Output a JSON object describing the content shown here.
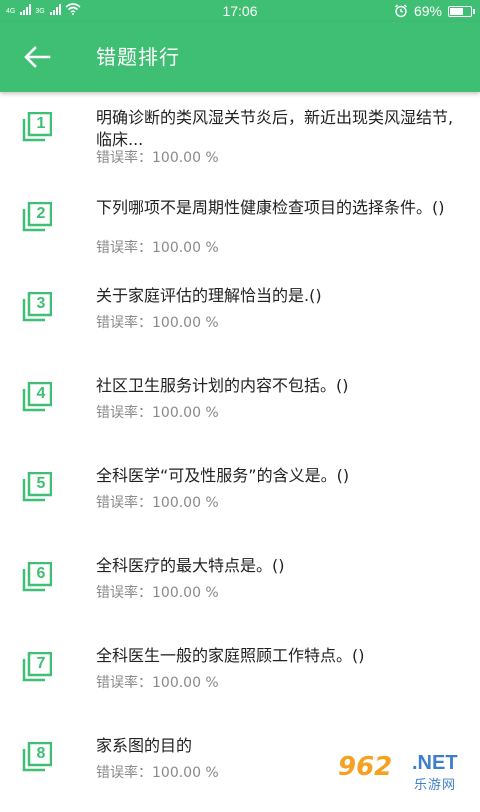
{
  "status_bar": {
    "network_1": "4G",
    "network_2": "3G",
    "time": "17:06",
    "alarm_icon": "alarm-clock-icon",
    "battery_percent_text": "69%",
    "battery_level": 0.69
  },
  "app_bar": {
    "back_icon": "arrow-back-icon",
    "title": "错题排行"
  },
  "theme": {
    "primary": "#3fbf74",
    "text_primary": "#222222",
    "text_secondary": "#8a8a8a"
  },
  "items": [
    {
      "rank": "1",
      "question": "明确诊断的类风湿关节炎后，新近出现类风湿结节,临床...",
      "rate_label": "错误率：",
      "rate": "100.00 %"
    },
    {
      "rank": "2",
      "question": "下列哪项不是周期性健康检查项目的选择条件。()",
      "rate_label": "错误率：",
      "rate": "100.00 %"
    },
    {
      "rank": "3",
      "question": "关于家庭评估的理解恰当的是.()",
      "rate_label": "错误率：",
      "rate": "100.00 %"
    },
    {
      "rank": "4",
      "question": "社区卫生服务计划的内容不包括。()",
      "rate_label": "错误率：",
      "rate": "100.00 %"
    },
    {
      "rank": "5",
      "question": "全科医学“可及性服务”的含义是。()",
      "rate_label": "错误率：",
      "rate": "100.00 %"
    },
    {
      "rank": "6",
      "question": "全科医疗的最大特点是。()",
      "rate_label": "错误率：",
      "rate": "100.00 %"
    },
    {
      "rank": "7",
      "question": "全科医生一般的家庭照顾工作特点。()",
      "rate_label": "错误率：",
      "rate": "100.00 %"
    },
    {
      "rank": "8",
      "question": "家系图的目的",
      "rate_label": "错误率：",
      "rate": "100.00 %"
    }
  ],
  "watermark": {
    "logo_text": "962",
    "logo_suffix": ".NET",
    "sub_text": "乐游网"
  }
}
